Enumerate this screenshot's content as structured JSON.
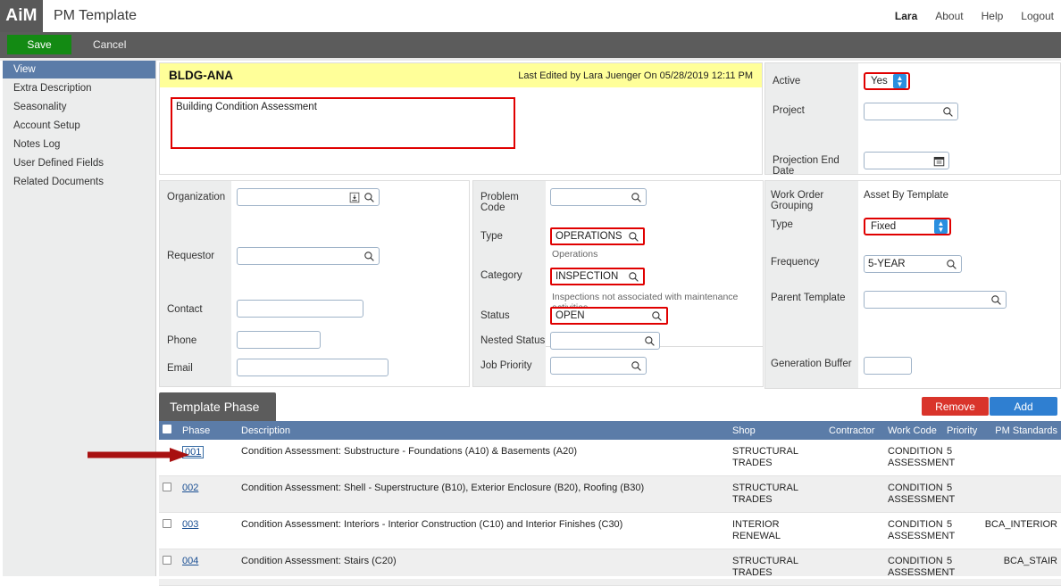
{
  "app": {
    "logo": "AiM",
    "title": "PM Template",
    "nav": [
      {
        "label": "Lara",
        "name": "user-menu"
      },
      {
        "label": "About",
        "name": "about-link"
      },
      {
        "label": "Help",
        "name": "help-link"
      },
      {
        "label": "Logout",
        "name": "logout-link"
      }
    ]
  },
  "actionbar": {
    "save_label": "Save",
    "cancel_label": "Cancel",
    "save_color": "#138a13"
  },
  "sidebar": {
    "items": [
      {
        "label": "View",
        "active": true
      },
      {
        "label": "Extra Description",
        "active": false
      },
      {
        "label": "Seasonality",
        "active": false
      },
      {
        "label": "Account Setup",
        "active": false
      },
      {
        "label": "Notes Log",
        "active": false
      },
      {
        "label": "User Defined Fields",
        "active": false
      },
      {
        "label": "Related Documents",
        "active": false
      }
    ],
    "active_color": "#5b7ca8"
  },
  "header": {
    "code": "BLDG-ANA",
    "last_edited": "Last Edited by Lara Juenger On 05/28/2019 12:11 PM",
    "description_value": "Building Condition Assessment",
    "banner_color": "#ffff99",
    "highlight_color": "#e00000"
  },
  "right_top": {
    "active_label": "Active",
    "active_value": "Yes",
    "project_label": "Project",
    "project_value": "",
    "projection_end_date_label": "Projection End Date",
    "projection_end_date_value": ""
  },
  "org_panel": {
    "organization_label": "Organization",
    "organization_value": "",
    "requestor_label": "Requestor",
    "requestor_value": "",
    "contact_label": "Contact",
    "contact_value": "",
    "phone_label": "Phone",
    "phone_value": "",
    "email_label": "Email",
    "email_value": ""
  },
  "class_panel": {
    "problem_code_label": "Problem Code",
    "problem_code_value": "",
    "type_label": "Type",
    "type_value": "OPERATIONS",
    "type_hint": "Operations",
    "category_label": "Category",
    "category_value": "INSPECTION",
    "category_hint": "Inspections not associated with maintenance activities",
    "status_label": "Status",
    "status_value": "OPEN",
    "nested_status_label": "Nested Status",
    "nested_status_value": "",
    "job_priority_label": "Job Priority",
    "job_priority_value": ""
  },
  "schedule_panel": {
    "work_order_grouping_label": "Work Order Grouping",
    "work_order_grouping_value": "Asset By Template",
    "type_label": "Type",
    "type_value": "Fixed",
    "frequency_label": "Frequency",
    "frequency_value": "5-YEAR",
    "parent_template_label": "Parent Template",
    "parent_template_value": "",
    "generation_buffer_label": "Generation Buffer",
    "generation_buffer_value": ""
  },
  "template_phase": {
    "tab_label": "Template Phase",
    "remove_label": "Remove",
    "add_label": "Add",
    "remove_color": "#d9342b",
    "add_color": "#2f7fd1",
    "columns": [
      "Phase",
      "Description",
      "Shop",
      "Contractor",
      "Work Code",
      "Priority",
      "PM Standards"
    ],
    "rows": [
      {
        "phase": "001",
        "description": "Condition Assessment: Substructure - Foundations (A10) & Basements (A20)",
        "shop": "STRUCTURAL TRADES",
        "contractor": "",
        "work_code": "CONDITION ASSESSMENT",
        "priority": "5",
        "pm_standards": "",
        "selected": true
      },
      {
        "phase": "002",
        "description": "Condition Assessment: Shell - Superstructure (B10), Exterior Enclosure (B20), Roofing (B30)",
        "shop": "STRUCTURAL TRADES",
        "contractor": "",
        "work_code": "CONDITION ASSESSMENT",
        "priority": "5",
        "pm_standards": "",
        "selected": false
      },
      {
        "phase": "003",
        "description": "Condition Assessment: Interiors - Interior Construction (C10) and Interior Finishes (C30)",
        "shop": "INTERIOR RENEWAL",
        "contractor": "",
        "work_code": "CONDITION ASSESSMENT",
        "priority": "5",
        "pm_standards": "BCA_INTERIOR",
        "selected": false
      },
      {
        "phase": "004",
        "description": "Condition Assessment: Stairs (C20)",
        "shop": "STRUCTURAL TRADES",
        "contractor": "",
        "work_code": "CONDITION ASSESSMENT",
        "priority": "5",
        "pm_standards": "BCA_STAIR",
        "selected": false
      }
    ]
  },
  "annotation": {
    "arrow_color": "#a81010",
    "target": "001"
  }
}
